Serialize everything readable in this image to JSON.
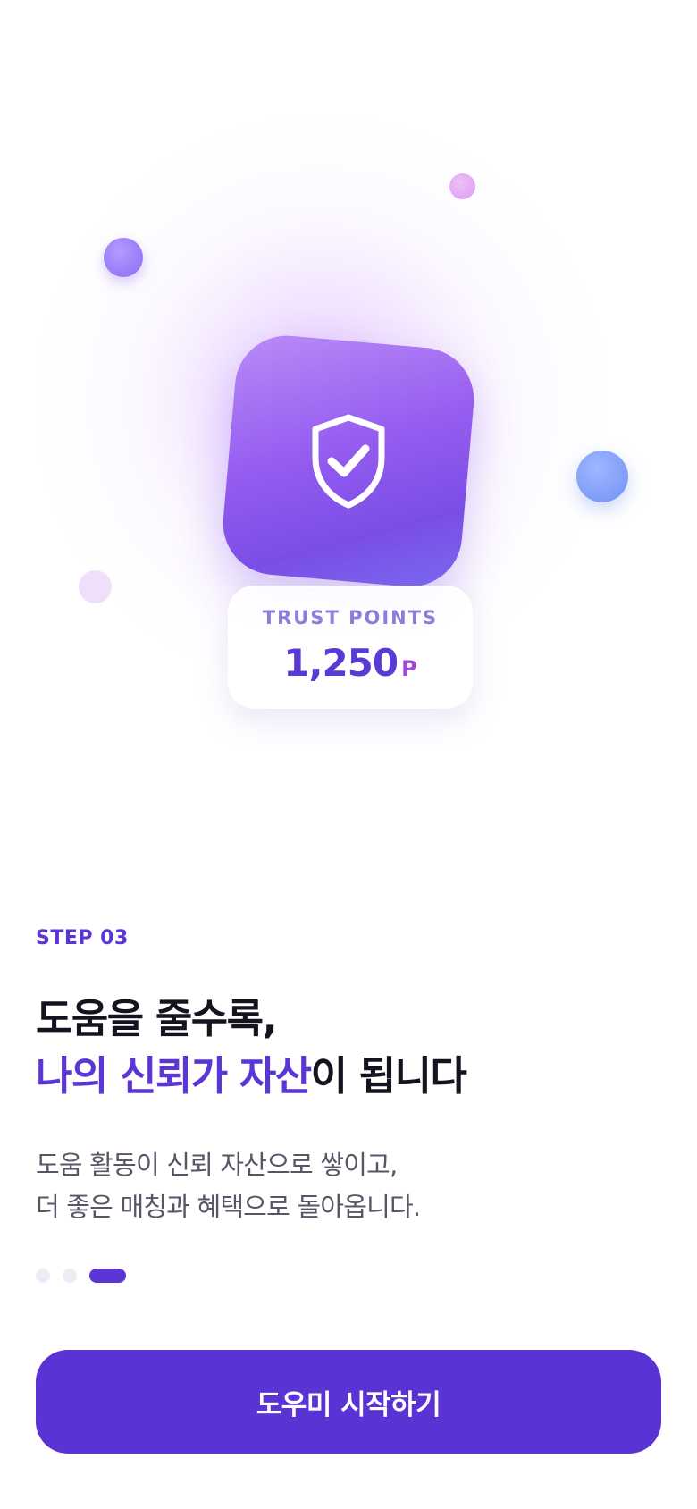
{
  "hero": {
    "icon": "shield-check-icon",
    "trust_card": {
      "label": "TRUST POINTS",
      "value": "1,250",
      "unit": "P"
    },
    "colors": {
      "card_top": "#b98cf7",
      "card_bottom": "#7a4ee6",
      "trust_value": "#5a3ad4"
    }
  },
  "onboarding": {
    "step_label": "STEP 03",
    "headline_line1": "도움을 줄수록,",
    "headline_line2_accent": "나의 신뢰가 자산",
    "headline_line2_rest": "이 됩니다",
    "description_line1": "도움 활동이 신뢰 자산으로 쌓이고,",
    "description_line2": "더 좋은 매칭과 혜택으로 돌아옵니다."
  },
  "pagination": {
    "total": 3,
    "current": 3
  },
  "cta": {
    "label": "도우미 시작하기"
  },
  "colors": {
    "accent": "#5b35d5",
    "headline": "#161320",
    "body": "#555766",
    "inactive_dot": "#ececf4"
  }
}
